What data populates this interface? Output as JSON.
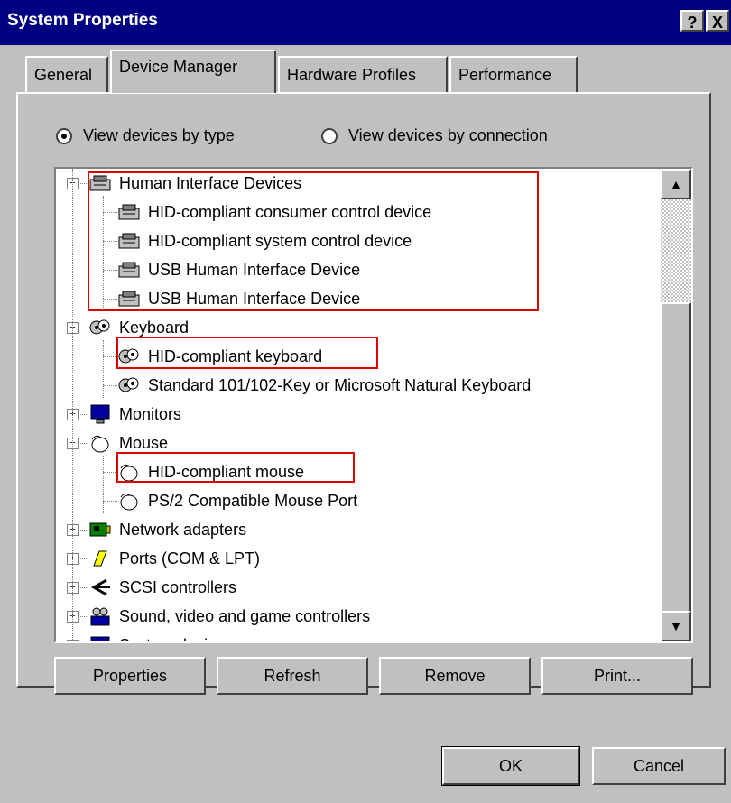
{
  "window": {
    "title": "System Properties",
    "help_glyph": "?",
    "close_glyph": "X"
  },
  "tabs": [
    {
      "label": "General"
    },
    {
      "label": "Device Manager"
    },
    {
      "label": "Hardware Profiles"
    },
    {
      "label": "Performance"
    }
  ],
  "view": {
    "by_type": "View devices by type",
    "by_connection": "View devices by connection",
    "selected": "by_type"
  },
  "tree": [
    {
      "label": "Human Interface Devices",
      "level": 0,
      "expander": "−",
      "icon": "hid-icon",
      "highlight": false
    },
    {
      "label": "HID-compliant consumer control device",
      "level": 1,
      "icon": "hid-icon"
    },
    {
      "label": "HID-compliant system control device",
      "level": 1,
      "icon": "hid-icon"
    },
    {
      "label": "USB Human Interface Device",
      "level": 1,
      "icon": "hid-icon"
    },
    {
      "label": "USB Human Interface Device",
      "level": 1,
      "icon": "hid-icon"
    },
    {
      "label": "Keyboard",
      "level": 0,
      "expander": "−",
      "icon": "keyboard-icon"
    },
    {
      "label": "HID-compliant keyboard",
      "level": 1,
      "icon": "keyboard-icon"
    },
    {
      "label": "Standard 101/102-Key or Microsoft Natural Keyboard",
      "level": 1,
      "icon": "keyboard-icon"
    },
    {
      "label": "Monitors",
      "level": 0,
      "expander": "+",
      "icon": "monitor-icon"
    },
    {
      "label": "Mouse",
      "level": 0,
      "expander": "−",
      "icon": "mouse-icon"
    },
    {
      "label": "HID-compliant mouse",
      "level": 1,
      "icon": "mouse-icon"
    },
    {
      "label": "PS/2 Compatible Mouse Port",
      "level": 1,
      "icon": "mouse-icon"
    },
    {
      "label": "Network adapters",
      "level": 0,
      "expander": "+",
      "icon": "network-adapter-icon"
    },
    {
      "label": "Ports (COM & LPT)",
      "level": 0,
      "expander": "+",
      "icon": "port-icon"
    },
    {
      "label": "SCSI controllers",
      "level": 0,
      "expander": "+",
      "icon": "scsi-icon"
    },
    {
      "label": "Sound, video and game controllers",
      "level": 0,
      "expander": "+",
      "icon": "sound-icon"
    },
    {
      "label": "System devices",
      "level": 0,
      "expander": "+",
      "icon": "system-icon"
    }
  ],
  "buttons": {
    "properties": "Properties",
    "refresh": "Refresh",
    "remove": "Remove",
    "print": "Print...",
    "ok": "OK",
    "cancel": "Cancel"
  },
  "colors": {
    "titlebar": "#000080",
    "face": "#c0c0c0",
    "highlight_box": "#e00000"
  }
}
